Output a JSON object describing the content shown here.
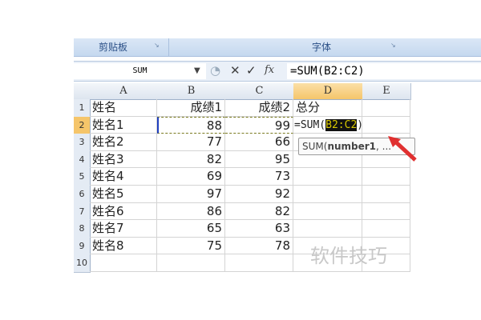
{
  "ribbon": {
    "groups": [
      {
        "label": "剪贴板"
      },
      {
        "label": "字体"
      }
    ]
  },
  "formula_bar": {
    "name_box": "SUM",
    "cancel_icon": "✕",
    "enter_icon": "✓",
    "fx_label": "fx",
    "formula": "=SUM(B2:C2)"
  },
  "columns": [
    "A",
    "B",
    "C",
    "D",
    "E"
  ],
  "rows": [
    {
      "n": "1",
      "a": "姓名",
      "b": "成绩1",
      "c": "成绩2",
      "d": "总分"
    },
    {
      "n": "2",
      "a": "姓名1",
      "b": "88",
      "c": "99",
      "d": ""
    },
    {
      "n": "3",
      "a": "姓名2",
      "b": "77",
      "c": "66",
      "d": ""
    },
    {
      "n": "4",
      "a": "姓名3",
      "b": "82",
      "c": "95",
      "d": ""
    },
    {
      "n": "5",
      "a": "姓名4",
      "b": "69",
      "c": "73",
      "d": ""
    },
    {
      "n": "6",
      "a": "姓名5",
      "b": "97",
      "c": "92",
      "d": ""
    },
    {
      "n": "7",
      "a": "姓名6",
      "b": "86",
      "c": "82",
      "d": ""
    },
    {
      "n": "8",
      "a": "姓名7",
      "b": "65",
      "c": "63",
      "d": ""
    },
    {
      "n": "9",
      "a": "姓名8",
      "b": "75",
      "c": "78",
      "d": ""
    },
    {
      "n": "10",
      "a": "",
      "b": "",
      "c": "",
      "d": ""
    }
  ],
  "editing_cell": {
    "prefix": "=SUM(",
    "range": "B2:C2",
    "suffix": ")"
  },
  "tooltip": {
    "fn": "SUM(",
    "arg": "number1",
    "rest": ", ..."
  },
  "watermark": "软件技巧",
  "colors": {
    "accent_column": "#f7c86b",
    "range_highlight": "#d8c800"
  }
}
